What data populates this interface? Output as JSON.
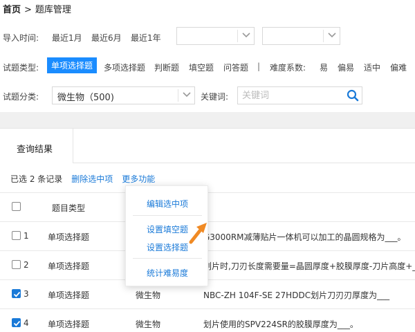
{
  "breadcrumb": {
    "home": "首页",
    "separator": ">",
    "current": "题库管理"
  },
  "filters": {
    "import_time_label": "导入时间:",
    "time_options": [
      "最近1月",
      "最近6月",
      "最近1年"
    ],
    "type_label": "试题类型:",
    "type_options": [
      "单项选择题",
      "多项选择题",
      "判断题",
      "填空题",
      "问答题"
    ],
    "type_divider": "|",
    "difficulty_label": "难度系数:",
    "difficulty_options": [
      "易",
      "偏易",
      "适中",
      "偏难"
    ],
    "category_label": "试题分类:",
    "category_value": "微生物（500)",
    "keyword_label": "关键词:",
    "keyword_placeholder": "关键词"
  },
  "results": {
    "tab": "查询结果",
    "selected_count": "已选 2 条记录",
    "delete_link": "删除选中项",
    "more_link": "更多功能",
    "header_type": "题目类型",
    "rows": [
      {
        "num": "1",
        "type": "单项选择题",
        "category": "",
        "question": "G3000RM减薄贴片一体机可以加工的晶圆规格为___。",
        "checked": false
      },
      {
        "num": "2",
        "type": "单项选择题",
        "category": "",
        "question": "划片时,刀刃长度需要量=晶圆厚度+胶膜厚度-刀片高度+_",
        "checked": false
      },
      {
        "num": "3",
        "type": "单项选择题",
        "category": "微生物",
        "question": "NBC-ZH 104F-SE 27HDDC划片刀刃刃厚度为___",
        "checked": true
      },
      {
        "num": "4",
        "type": "单项选择题",
        "category": "微生物",
        "question": "划片使用的SPV224SR的胶膜厚度为___。",
        "checked": true
      }
    ]
  },
  "more_menu": {
    "items": [
      "编辑选中项",
      "设置填空题",
      "设置选择题",
      "统计难易度"
    ]
  },
  "colors": {
    "accent": "#1a8cff",
    "link": "#1a7ad8",
    "pointer": "#f08a24"
  }
}
